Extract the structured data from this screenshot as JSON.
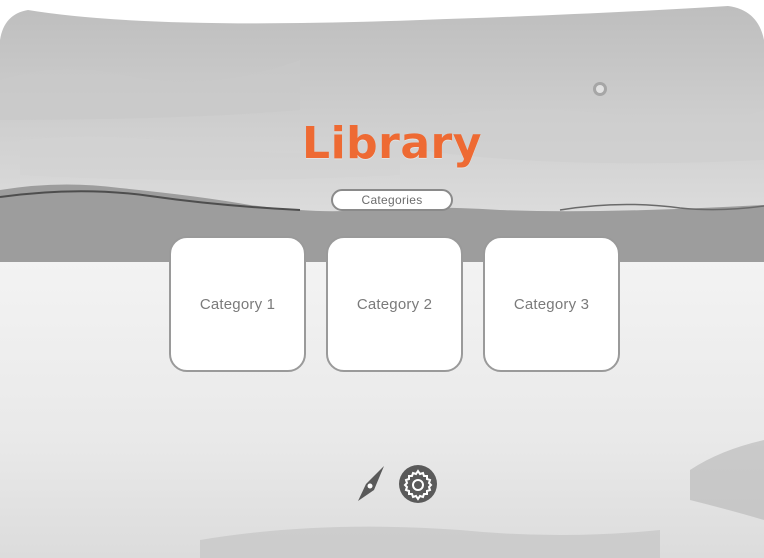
{
  "library": {
    "title": "Library",
    "section_button_label": "Categories"
  },
  "categories": [
    {
      "label": "Category 1"
    },
    {
      "label": "Category 2"
    },
    {
      "label": "Category 3"
    }
  ],
  "toolbar": {
    "icons": [
      "compass-icon",
      "gear-icon"
    ]
  },
  "colors": {
    "title": "#ee6a33",
    "card_border": "#9a9a9a",
    "card_text": "#7a7a7a",
    "icon_fill": "#5a5a5a"
  }
}
